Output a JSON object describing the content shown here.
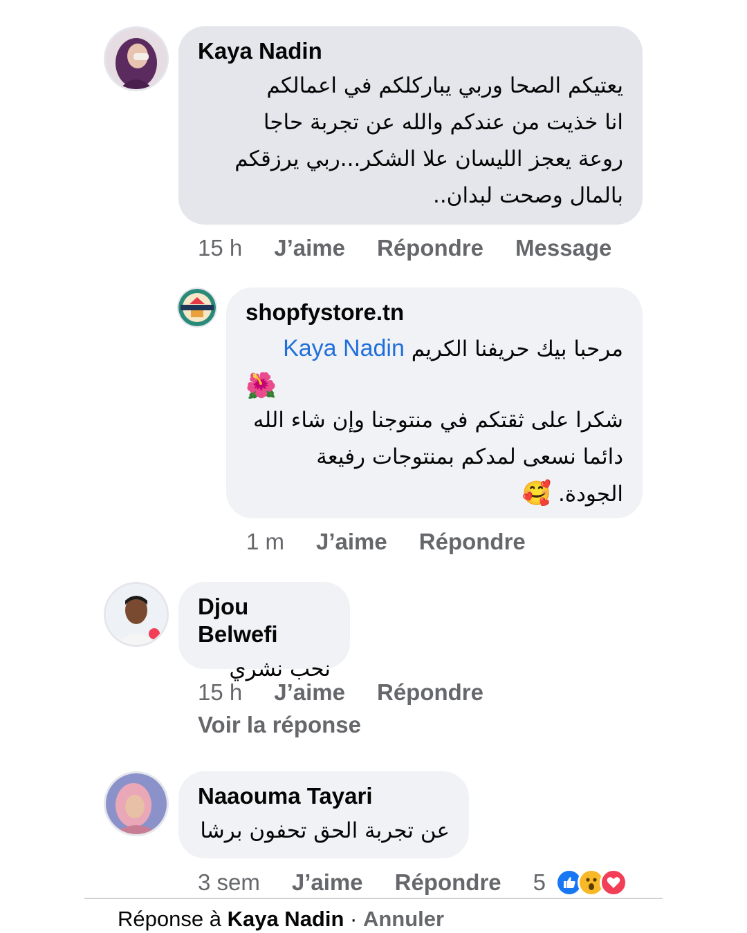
{
  "comments": [
    {
      "author": "Kaya Nadin",
      "lines": [
        "يعتيكم  الصحا وربي يباركلكم في اعمالكم",
        "انا خذيت من عندكم والله عن تجربة حاجا",
        "روعة يعجز الليسان علا الشكر...ربي يرزقكم",
        "بالمال وصحت لبدان.."
      ],
      "time": "15 h",
      "like": "J’aime",
      "reply": "Répondre",
      "message": "Message"
    },
    {
      "author": "shopfystore.tn",
      "mention": "Kaya Nadin",
      "line1": "مرحبا بيك حريفنا الكريم",
      "emoji1": "🌺",
      "lines": [
        "شكرا على ثقتكم في منتوجنا وإن شاء الله",
        "دائما نسعى لمدكم بمنتوجات رفيعة"
      ],
      "last_line": "الجودة.",
      "emoji2": "🥰",
      "time": "1 m",
      "like": "J’aime",
      "reply": "Répondre",
      "logo_text": "SHOPFY STORE"
    },
    {
      "author": "Djou Belwefi",
      "text": "نحب نشري",
      "time": "15 h",
      "like": "J’aime",
      "reply": "Répondre",
      "see_reply": "Voir la réponse"
    },
    {
      "author": "Naaouma Tayari",
      "text": "عن تجربة الحق تحفون برشا",
      "time": "3 sem",
      "like": "J’aime",
      "reply": "Répondre",
      "reaction_count": "5"
    }
  ],
  "reply_bar": {
    "prefix": "Réponse à",
    "name": "Kaya Nadin",
    "separator": " · ",
    "cancel": "Annuler"
  },
  "colors": {
    "bubble": "#f0f2f5",
    "bubble_highlight": "#e4e6eb",
    "meta_text": "#65676b",
    "mention": "#216fdb",
    "like_blue": "#1877f2",
    "love_red": "#f33e58",
    "wow_yellow": "#f7b928"
  }
}
